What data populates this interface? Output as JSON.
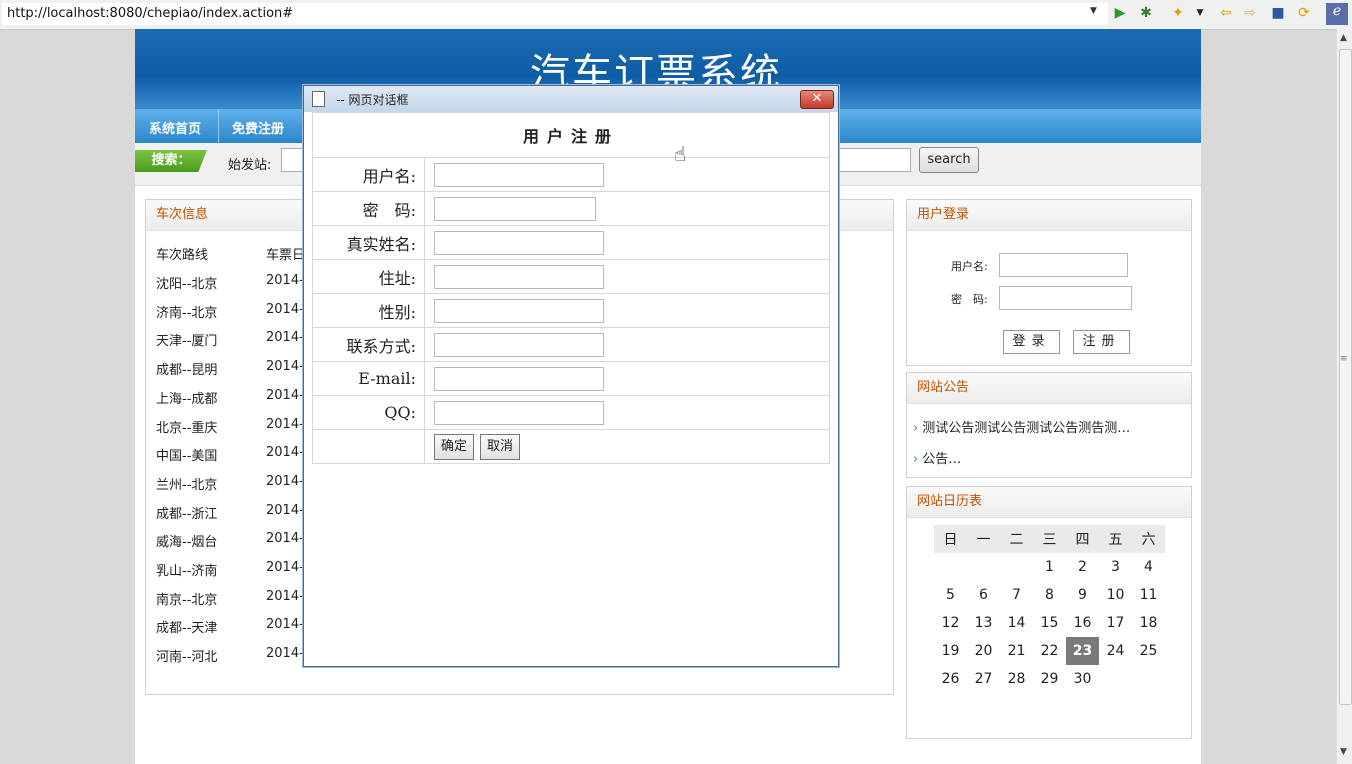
{
  "browser": {
    "url": "http://localhost:8080/chepiao/index.action#"
  },
  "site": {
    "title": "汽车订票系统",
    "nav": [
      "系统首页",
      "免费注册"
    ]
  },
  "search": {
    "tag": "搜索：",
    "start_label": "始发站:",
    "button": "search"
  },
  "trips": {
    "panel_title": "车次信息",
    "col_route": "车次路线",
    "col_date": "车票日",
    "rows": [
      {
        "route": "沈阳--北京",
        "date": "2014-"
      },
      {
        "route": "济南--北京",
        "date": "2014-"
      },
      {
        "route": "天津--厦门",
        "date": "2014-"
      },
      {
        "route": "成都--昆明",
        "date": "2014-"
      },
      {
        "route": "上海--成都",
        "date": "2014-"
      },
      {
        "route": "北京--重庆",
        "date": "2014-"
      },
      {
        "route": "中国--美国",
        "date": "2014-"
      },
      {
        "route": "兰州--北京",
        "date": "2014-"
      },
      {
        "route": "成都--浙江",
        "date": "2014-"
      },
      {
        "route": "威海--烟台",
        "date": "2014-"
      },
      {
        "route": "乳山--济南",
        "date": "2014-"
      },
      {
        "route": "南京--北京",
        "date": "2014-"
      },
      {
        "route": "成都--天津",
        "date": "2014-"
      },
      {
        "route": "河南--河北",
        "date": "2014-"
      }
    ]
  },
  "login": {
    "panel_title": "用户登录",
    "username_label": "用户名:",
    "password_label": "密　码:",
    "login_button": "登录",
    "register_button": "注册"
  },
  "notices": {
    "panel_title": "网站公告",
    "items": [
      "测试公告测试公告测试公告测告测…",
      "公告…"
    ]
  },
  "calendar": {
    "panel_title": "网站日历表",
    "weekdays": [
      "日",
      "一",
      "二",
      "三",
      "四",
      "五",
      "六"
    ],
    "weeks": [
      [
        "",
        "",
        "",
        "1",
        "2",
        "3",
        "4"
      ],
      [
        "5",
        "6",
        "7",
        "8",
        "9",
        "10",
        "11"
      ],
      [
        "12",
        "13",
        "14",
        "15",
        "16",
        "17",
        "18"
      ],
      [
        "19",
        "20",
        "21",
        "22",
        "23",
        "24",
        "25"
      ],
      [
        "26",
        "27",
        "28",
        "29",
        "30",
        "",
        ""
      ]
    ],
    "today": "23"
  },
  "dialog": {
    "title": "-- 网页对话框",
    "close": "✕",
    "form_caption": "用户注册",
    "fields": [
      {
        "label": "用户名:"
      },
      {
        "label": "密　码:"
      },
      {
        "label": "真实姓名:"
      },
      {
        "label": "住址:"
      },
      {
        "label": "性别:"
      },
      {
        "label": "联系方式:"
      },
      {
        "label": "E-mail:"
      },
      {
        "label": "QQ:"
      }
    ],
    "confirm_button": "确定",
    "cancel_button": "取消"
  }
}
